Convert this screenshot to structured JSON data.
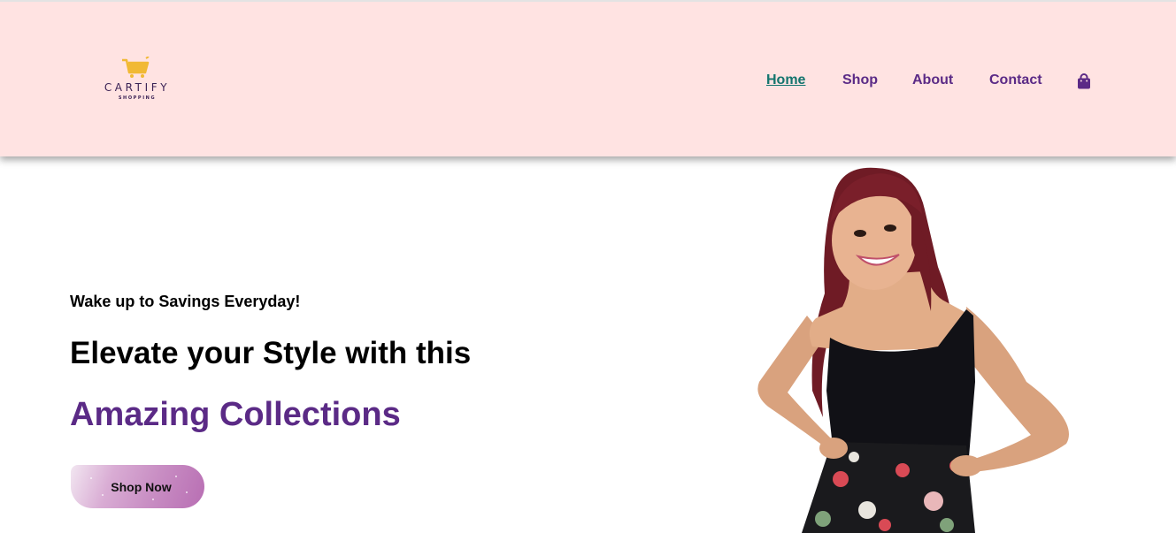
{
  "brand": {
    "name": "CARTIFY",
    "tagline": "SHOPPING",
    "logo_icon": "shopping-cart-icon",
    "colors": {
      "cart": "#f1b935",
      "text": "#3b2255"
    }
  },
  "nav": {
    "items": [
      {
        "label": "Home",
        "active": true
      },
      {
        "label": "Shop",
        "active": false
      },
      {
        "label": "About",
        "active": false
      },
      {
        "label": "Contact",
        "active": false
      }
    ],
    "cart_icon": "shopping-bag-icon"
  },
  "hero": {
    "subtitle": "Wake up to Savings Everyday!",
    "title_line1": "Elevate your Style with this",
    "title_line2": "Amazing Collections",
    "cta_label": "Shop Now",
    "image": "model-photo"
  },
  "theme": {
    "header_bg": "#ffe3e2",
    "accent_purple": "#5b2a86",
    "active_link": "#14756e"
  }
}
